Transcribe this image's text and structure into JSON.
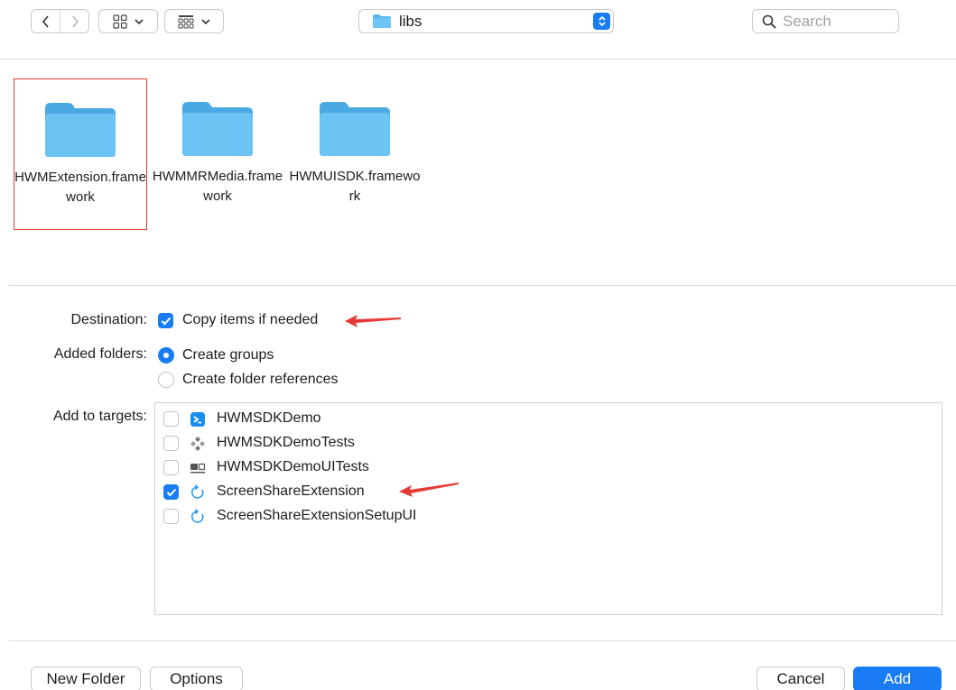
{
  "toolbar": {
    "path": {
      "label": "libs"
    },
    "search": {
      "placeholder": "Search",
      "value": ""
    }
  },
  "files": [
    {
      "name": "HWMExtension.framework",
      "selected": true
    },
    {
      "name": "HWMMRMedia.framework",
      "selected": false
    },
    {
      "name": "HWMUISDK.framework",
      "selected": false
    }
  ],
  "options": {
    "destination": {
      "label": "Destination:",
      "checkbox_label": "Copy items if needed",
      "checked": true
    },
    "added_folders": {
      "label": "Added folders:",
      "choices": [
        {
          "label": "Create groups",
          "selected": true
        },
        {
          "label": "Create folder references",
          "selected": false
        }
      ]
    },
    "targets": {
      "label": "Add to targets:",
      "items": [
        {
          "label": "HWMSDKDemo",
          "checked": false,
          "icon": "app-target-icon"
        },
        {
          "label": "HWMSDKDemoTests",
          "checked": false,
          "icon": "unit-test-icon"
        },
        {
          "label": "HWMSDKDemoUITests",
          "checked": false,
          "icon": "ui-test-icon"
        },
        {
          "label": "ScreenShareExtension",
          "checked": true,
          "icon": "extension-icon"
        },
        {
          "label": "ScreenShareExtensionSetupUI",
          "checked": false,
          "icon": "extension-icon"
        }
      ]
    }
  },
  "buttons": {
    "new_folder": "New Folder",
    "options": "Options",
    "cancel": "Cancel",
    "add": "Add"
  },
  "colors": {
    "accent": "#1a7cf5",
    "annotation": "#e53935",
    "folder": "#5ab8f0"
  }
}
